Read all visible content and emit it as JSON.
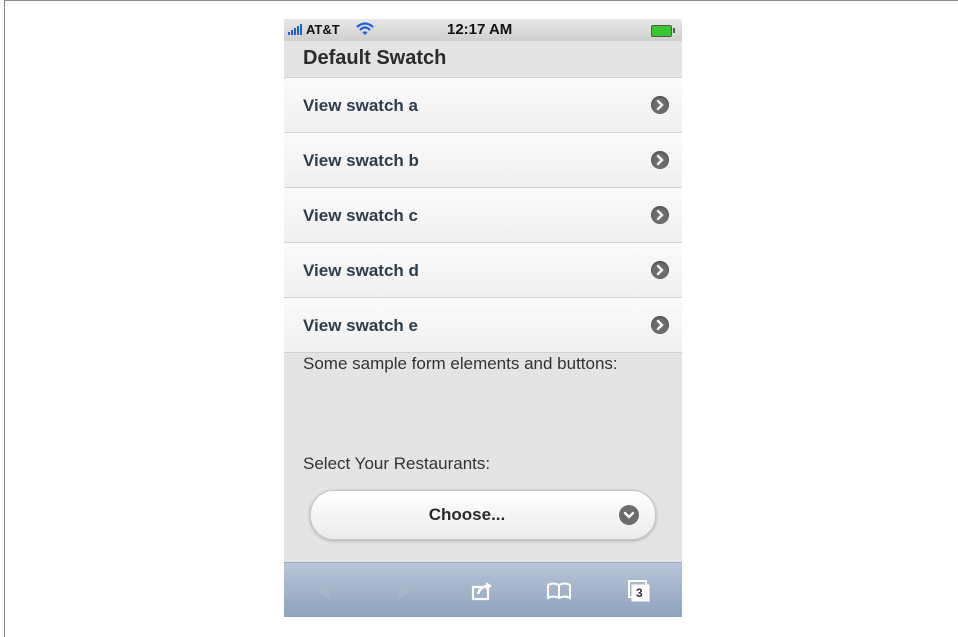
{
  "status_bar": {
    "carrier": "AT&T",
    "time": "12:17 AM",
    "signal_icon": "signal-bars-icon",
    "wifi_icon": "wifi-icon",
    "battery_icon": "battery-icon"
  },
  "header": {
    "title": "Default Swatch"
  },
  "list": {
    "items": [
      {
        "label": "View swatch a",
        "icon": "chevron-right-icon"
      },
      {
        "label": "View swatch b",
        "icon": "chevron-right-icon"
      },
      {
        "label": "View swatch c",
        "icon": "chevron-right-icon"
      },
      {
        "label": "View swatch d",
        "icon": "chevron-right-icon"
      },
      {
        "label": "View swatch e",
        "icon": "chevron-right-icon"
      }
    ]
  },
  "content": {
    "intro": "Some sample form elements and buttons:",
    "select_label": "Select Your Restaurants:",
    "select_value": "Choose..."
  },
  "toolbar": {
    "back_icon": "back-arrow-icon",
    "forward_icon": "forward-arrow-icon",
    "share_icon": "share-icon",
    "bookmarks_icon": "bookmarks-icon",
    "tabs_icon": "tabs-icon",
    "tabs_count": "3"
  },
  "colors": {
    "list_text": "#2e3d4c",
    "page_bg": "#e4e4e4",
    "toolbar_top": "#b7c5d8",
    "toolbar_bottom": "#8ea2bd"
  }
}
